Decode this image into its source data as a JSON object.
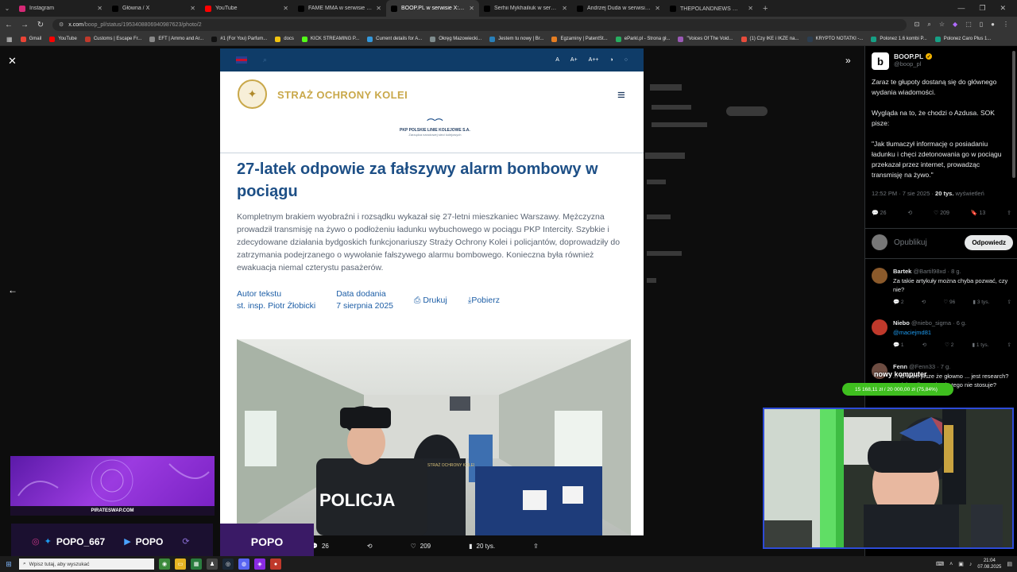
{
  "tabs": [
    {
      "title": "Instagram",
      "color": "#d62976",
      "active": false
    },
    {
      "title": "Główna / X",
      "color": "#000000",
      "active": false
    },
    {
      "title": "YouTube",
      "color": "#ff0000",
      "active": false
    },
    {
      "title": "FAME MMA w serwisie X: „TUS...",
      "color": "#000000",
      "active": false
    },
    {
      "title": "BOOP.PL w serwisie X: „Zaraz te...",
      "color": "#000000",
      "active": true
    },
    {
      "title": "Serhii Mykhailiuk w serwisie X: ...",
      "color": "#000000",
      "active": false
    },
    {
      "title": "Andrzej Duda w serwisie X: „Po...",
      "color": "#000000",
      "active": false
    },
    {
      "title": "THEPOLANDNEWS 🔵 w serwisie...",
      "color": "#000000",
      "active": false
    }
  ],
  "address": {
    "host": "x.com",
    "path": "/boop_pl/status/1953408806940987623/photo/2"
  },
  "bookmarks": [
    {
      "label": "Gmail",
      "color": "#ea4335"
    },
    {
      "label": "YouTube",
      "color": "#ff0000"
    },
    {
      "label": "Customs | Escape Fr...",
      "color": "#c0392b"
    },
    {
      "label": "EFT | Ammo and Ar...",
      "color": "#888888"
    },
    {
      "label": "#1 (For You) Parfum...",
      "color": "#111111"
    },
    {
      "label": "docs",
      "color": "#f1c40f"
    },
    {
      "label": "KICK STREAMING P...",
      "color": "#53fc18"
    },
    {
      "label": "Current details for A...",
      "color": "#3498db"
    },
    {
      "label": "Okręg Mazowiecki...",
      "color": "#7f8c8d"
    },
    {
      "label": "Jestem tu nowy | Br...",
      "color": "#2980b9"
    },
    {
      "label": "Egzaminy | PatentSt...",
      "color": "#e67e22"
    },
    {
      "label": "eParkl.pl - Strona gł...",
      "color": "#27ae60"
    },
    {
      "label": "\"Voices Of The Void...",
      "color": "#9b59b6"
    },
    {
      "label": "(1) Czy IKE i IKZE na...",
      "color": "#e74c3c"
    },
    {
      "label": "KRYPTO NOTATKI -...",
      "color": "#2c3e50"
    },
    {
      "label": "Polonez 1.6 kombi P...",
      "color": "#16a085"
    },
    {
      "label": "Polonez Caro Plus 1...",
      "color": "#16a085"
    }
  ],
  "article": {
    "font_sizes": [
      "A",
      "A+",
      "A++"
    ],
    "brand": "STRAŻ OCHRONY KOLEI",
    "pkp_name": "PKP POLSKIE LINIE KOLEJOWE S.A.",
    "pkp_sub": "Zarządca narodowej sieci kolejowych",
    "title": "27-latek odpowie za fałszywy alarm bombowy w pociągu",
    "lead": "Kompletnym brakiem wyobraźni i rozsądku wykazał się 27-letni mieszkaniec Warszawy. Mężczyzna prowadził transmisję na żywo o podłożeniu ładunku wybuchowego w pociągu PKP Intercity. Szybkie i zdecydowane działania bydgoskich funkcjonariuszy Straży Ochrony Kolei i policjantów, doprowadziły do zatrzymania podejrzanego o wywołanie fałszywego alarmu bombowego. Konieczna była również ewakuacja niemal czterystu pasażerów.",
    "author_label": "Autor tekstu",
    "author_value": "st. insp. Piotr Żłobicki",
    "date_label": "Data dodania",
    "date_value": "7 sierpnia 2025",
    "print_label": "Drukuj",
    "download_label": "Pobierz",
    "photo_vest_text": "POLICJA",
    "photo_vest2_text": "STRAŻ OCHRONY KOLEI"
  },
  "viewer_actions": {
    "replies": "26",
    "likes": "209",
    "views": "20 tys."
  },
  "tweet": {
    "author_name": "BOOP.PL",
    "author_handle": "@boop_pl",
    "text": "Zaraz te głupoty dostaną się do głównego wydania wiadomości.\n\nWygląda na to, że chodzi o Azdusa. SOK pisze:\n\n\"Jak tłumaczył informację o posiadaniu ładunku i chęci zdetonowania go w pociągu przekazał przez internet, prowadząc transmisję na żywo.\"",
    "time": "12:52 PM · 7 sie 2025 · ",
    "views_num": "20 tys.",
    "views_label": " wyświetleń",
    "replies": "26",
    "likes": "209",
    "bookmarks": "13",
    "reply_placeholder": "Opublikuj",
    "reply_button": "Odpowiedz"
  },
  "replies": [
    {
      "name": "Bartek",
      "meta": "@Bartil98xd · 8 g.",
      "text": "Za takie artykuły można chyba pozwać, czy nie?",
      "link": false,
      "avatar": "#8b5a2b",
      "replies": "2",
      "likes": "96",
      "views": "3 tys."
    },
    {
      "name": "Niebo",
      "meta": "@niebo_sigma · 6 g.",
      "text": "@maciejmd81",
      "link": true,
      "avatar": "#c0392b",
      "replies": "1",
      "likes": "2",
      "views": "1 tys."
    },
    {
      "name": "Fenn",
      "meta": "@Fenn33 · 7 g.",
      "text": "... to wam pisze że głowno ... jest research? ... dziennikarstwie się tego nie stosuje?",
      "link": false,
      "avatar": "#6d4c41",
      "replies": "",
      "likes": "",
      "views": ""
    }
  ],
  "stream": {
    "promo_site": "PIRATESWAP.COM",
    "social_name": "POPO_667",
    "yt_name": "POPO",
    "box_name": "POPO",
    "chat_label": "nowy komputer",
    "goal_text": "15 168,11 zł / 20 000,00 zł (75,84%)"
  },
  "taskbar": {
    "search_placeholder": "Wpisz tutaj, aby wyszukać",
    "time": "21:04",
    "date": "07.08.2025"
  }
}
